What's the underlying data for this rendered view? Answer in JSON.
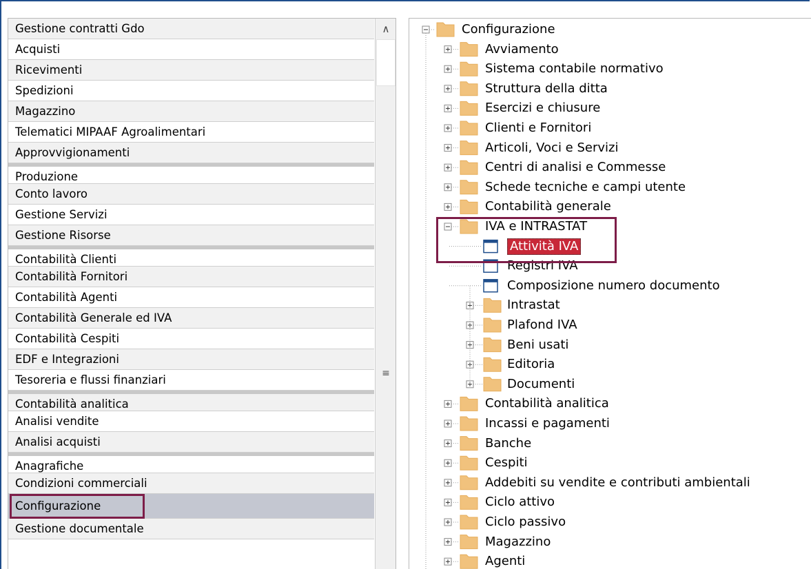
{
  "left_menu": {
    "items": [
      {
        "label": "Gestione contratti Gdo",
        "style": "gray",
        "group_top": false
      },
      {
        "label": "Acquisti",
        "style": "light",
        "group_top": false
      },
      {
        "label": "Ricevimenti",
        "style": "gray",
        "group_top": false
      },
      {
        "label": "Spedizioni",
        "style": "light",
        "group_top": false
      },
      {
        "label": "Magazzino",
        "style": "gray",
        "group_top": false
      },
      {
        "label": "Telematici MIPAAF Agroalimentari",
        "style": "light",
        "group_top": false
      },
      {
        "label": "Approvvigionamenti",
        "style": "gray",
        "group_top": false
      },
      {
        "label": "Produzione",
        "style": "light",
        "group_top": true
      },
      {
        "label": "Conto lavoro",
        "style": "gray",
        "group_top": false
      },
      {
        "label": "Gestione Servizi",
        "style": "light",
        "group_top": false
      },
      {
        "label": "Gestione Risorse",
        "style": "gray",
        "group_top": false
      },
      {
        "label": "Contabilità Clienti",
        "style": "light",
        "group_top": true
      },
      {
        "label": "Contabilità Fornitori",
        "style": "gray",
        "group_top": false
      },
      {
        "label": "Contabilità Agenti",
        "style": "light",
        "group_top": false
      },
      {
        "label": "Contabilità Generale ed IVA",
        "style": "gray",
        "group_top": false
      },
      {
        "label": "Contabilità Cespiti",
        "style": "light",
        "group_top": false
      },
      {
        "label": "EDF e Integrazioni",
        "style": "gray",
        "group_top": false
      },
      {
        "label": "Tesoreria e flussi finanziari",
        "style": "light",
        "group_top": false
      },
      {
        "label": "Contabilità analitica",
        "style": "gray",
        "group_top": true
      },
      {
        "label": "Analisi vendite",
        "style": "light",
        "group_top": false
      },
      {
        "label": "Analisi acquisti",
        "style": "gray",
        "group_top": false
      },
      {
        "label": "Anagrafiche",
        "style": "light",
        "group_top": true
      },
      {
        "label": "Condizioni commerciali",
        "style": "gray",
        "group_top": false
      },
      {
        "label": "Configurazione",
        "style": "selected",
        "group_top": false
      },
      {
        "label": "Gestione documentale",
        "style": "gray",
        "group_top": false
      }
    ],
    "selected": "Configurazione"
  },
  "scrollbar": {
    "up_icon": "chevron-up-icon",
    "grip_icon": "grip-lines-icon"
  },
  "tree": {
    "colors": {
      "folder": "#f1c27d",
      "folder_dark": "#e6ad5c",
      "selected_bg": "#c82838",
      "doc_border": "#1f4e8c",
      "highlight": "#7d1d48"
    },
    "root": "Configurazione",
    "top_children": [
      {
        "label": "Avviamento",
        "expanded": false
      },
      {
        "label": "Sistema contabile normativo",
        "expanded": false
      },
      {
        "label": "Struttura della ditta",
        "expanded": false
      },
      {
        "label": "Esercizi e chiusure",
        "expanded": false
      },
      {
        "label": "Clienti e Fornitori",
        "expanded": false
      },
      {
        "label": "Articoli, Voci e Servizi",
        "expanded": false
      },
      {
        "label": "Centri di analisi e Commesse",
        "expanded": false
      },
      {
        "label": "Schede tecniche e campi utente",
        "expanded": false
      },
      {
        "label": "Contabilità generale",
        "expanded": false
      },
      {
        "label": "IVA e INTRASTAT",
        "expanded": true
      },
      {
        "label": "Contabilità analitica",
        "expanded": false
      },
      {
        "label": "Incassi e pagamenti",
        "expanded": false
      },
      {
        "label": "Banche",
        "expanded": false
      },
      {
        "label": "Cespiti",
        "expanded": false
      },
      {
        "label": "Addebiti su vendite e contributi ambientali",
        "expanded": false
      },
      {
        "label": "Ciclo attivo",
        "expanded": false
      },
      {
        "label": "Ciclo passivo",
        "expanded": false
      },
      {
        "label": "Magazzino",
        "expanded": false
      },
      {
        "label": "Agenti",
        "expanded": false
      }
    ],
    "iva_children": [
      {
        "label": "Attività IVA",
        "type": "doc",
        "selected": true
      },
      {
        "label": "Registri IVA",
        "type": "doc",
        "selected": false
      },
      {
        "label": "Composizione numero documento",
        "type": "doc",
        "selected": false
      },
      {
        "label": "Intrastat",
        "type": "folder",
        "selected": false
      },
      {
        "label": "Plafond IVA",
        "type": "folder",
        "selected": false
      },
      {
        "label": "Beni usati",
        "type": "folder",
        "selected": false
      },
      {
        "label": "Editoria",
        "type": "folder",
        "selected": false
      },
      {
        "label": "Documenti",
        "type": "folder",
        "selected": false
      }
    ]
  }
}
